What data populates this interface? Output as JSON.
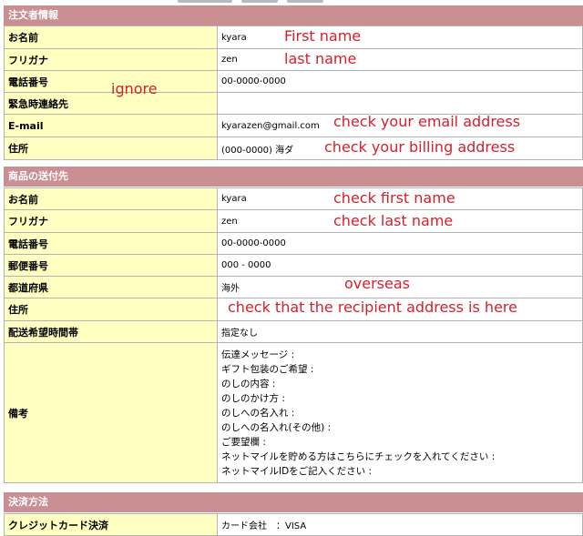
{
  "orderer": {
    "header": "注文者情報",
    "rows": [
      {
        "label": "お名前",
        "value": "kyara"
      },
      {
        "label": "フリガナ",
        "value": "zen"
      },
      {
        "label": "電話番号",
        "value": "00-0000-0000"
      },
      {
        "label": "緊急時連絡先",
        "value": ""
      },
      {
        "label": "E-mail",
        "value": "kyarazen@gmail.com"
      },
      {
        "label": "住所",
        "value": "(000-0000) 海ダ"
      }
    ]
  },
  "shipping": {
    "header": "商品の送付先",
    "rows": [
      {
        "label": "お名前",
        "value": "kyara"
      },
      {
        "label": "フリガナ",
        "value": "zen"
      },
      {
        "label": "電話番号",
        "value": "00-0000-0000"
      },
      {
        "label": "郵便番号",
        "value": "000 - 0000"
      },
      {
        "label": "都道府県",
        "value": "海外"
      },
      {
        "label": "住所",
        "value": ""
      },
      {
        "label": "配送希望時間帯",
        "value": "指定なし"
      }
    ],
    "remarks_label": "備考",
    "remarks_lines": [
      "伝達メッセージ :",
      "ギフト包装のご希望 :",
      "のしの内容 :",
      "のしのかけ方 :",
      "のしへの名入れ :",
      "のしへの名入れ(その他) :",
      "ご要望欄 :",
      "ネットマイルを貯める方はこちらにチェックを入れてください :",
      "ネットマイルIDをご記入ください :"
    ]
  },
  "payment": {
    "header": "決済方法",
    "rows": [
      {
        "label": "クレジットカード決済",
        "value": "カード会社　：VISA"
      }
    ]
  },
  "annotations": {
    "first_name": "First name",
    "last_name": "last name",
    "ignore": "ignore",
    "check_email": "check your email address",
    "check_billing": "check your billing address",
    "check_first": "check first name",
    "check_last": "check last name",
    "overseas": "overseas",
    "check_recipient": "check that the recipient address is here"
  },
  "colors": {
    "header_bg": "#c98f92",
    "label_bg": "#ffffc2",
    "annotation": "#d61f2a"
  }
}
